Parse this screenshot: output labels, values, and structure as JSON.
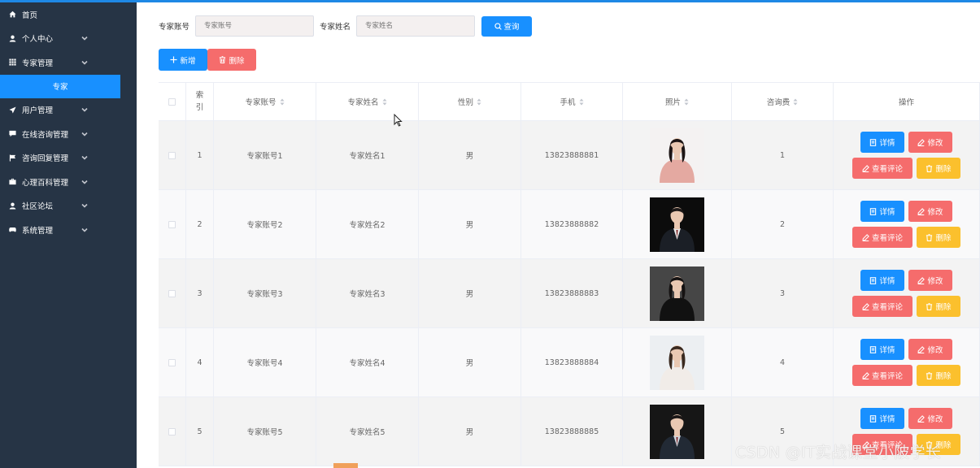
{
  "sidebar": {
    "items": [
      {
        "label": "首页",
        "icon": "home-icon",
        "has_chevron": false
      },
      {
        "label": "个人中心",
        "icon": "user-icon",
        "has_chevron": true
      },
      {
        "label": "专家管理",
        "icon": "grid-icon",
        "has_chevron": true
      },
      {
        "label": "专家",
        "is_sub": true,
        "active": true
      },
      {
        "label": "用户管理",
        "icon": "send-icon",
        "has_chevron": true
      },
      {
        "label": "在线咨询管理",
        "icon": "chat-icon",
        "has_chevron": true
      },
      {
        "label": "咨询回复管理",
        "icon": "flag-icon",
        "has_chevron": true
      },
      {
        "label": "心理百科管理",
        "icon": "briefcase-icon",
        "has_chevron": true
      },
      {
        "label": "社区论坛",
        "icon": "user-icon",
        "has_chevron": true
      },
      {
        "label": "系统管理",
        "icon": "gamepad-icon",
        "has_chevron": true
      }
    ]
  },
  "search": {
    "account_label": "专家账号",
    "account_placeholder": "专家账号",
    "name_label": "专家姓名",
    "name_placeholder": "专家姓名",
    "query_label": "查询"
  },
  "toolbar": {
    "add_label": "新增",
    "delete_label": "删除"
  },
  "table": {
    "headers": [
      "索引",
      "专家账号",
      "专家姓名",
      "性别",
      "手机",
      "照片",
      "咨询费",
      "操作"
    ],
    "rows": [
      {
        "index": "1",
        "account": "专家账号1",
        "name": "专家姓名1",
        "gender": "男",
        "phone": "13823888881",
        "fee": "1",
        "photo": "photo-woman-pink"
      },
      {
        "index": "2",
        "account": "专家账号2",
        "name": "专家姓名2",
        "gender": "男",
        "phone": "13823888882",
        "fee": "2",
        "photo": "photo-man-suit"
      },
      {
        "index": "3",
        "account": "专家账号3",
        "name": "专家姓名3",
        "gender": "男",
        "phone": "13823888883",
        "fee": "3",
        "photo": "photo-woman-black"
      },
      {
        "index": "4",
        "account": "专家账号4",
        "name": "专家姓名4",
        "gender": "男",
        "phone": "13823888884",
        "fee": "4",
        "photo": "photo-woman-white"
      },
      {
        "index": "5",
        "account": "专家账号5",
        "name": "专家姓名5",
        "gender": "男",
        "phone": "13823888885",
        "fee": "5",
        "photo": "photo-man-dark"
      }
    ],
    "ops": {
      "detail": "详情",
      "edit": "修改",
      "comment": "查看评论",
      "delete": "删除"
    }
  },
  "watermark": "CSDN @IT实战课堂小陂学长",
  "colors": {
    "sidebar_bg": "#263445",
    "active_menu": "#1890ff",
    "primary": "#1890ff",
    "danger": "#f56c6c",
    "warning": "#fbc02d",
    "row_alt_bg": "#f3f3f3"
  }
}
